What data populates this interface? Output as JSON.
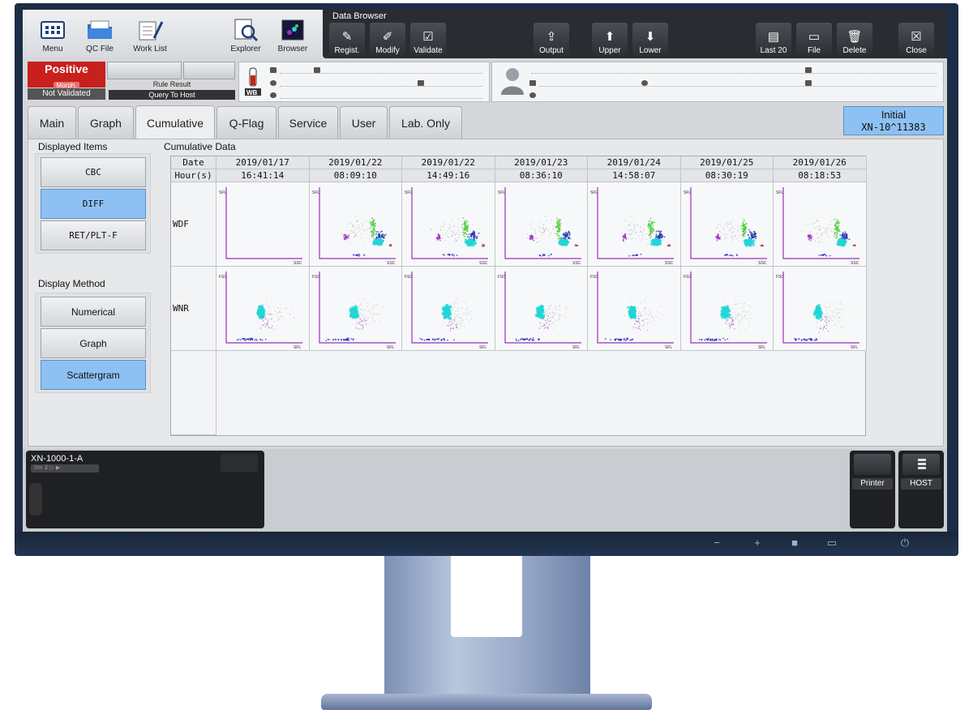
{
  "toolbar": {
    "menu": "Menu",
    "qc_file": "QC File",
    "work_list": "Work List",
    "explorer": "Explorer",
    "browser": "Browser"
  },
  "data_browser": {
    "title": "Data Browser",
    "buttons": [
      {
        "label": "Regist.",
        "glyph": "✎"
      },
      {
        "label": "Modify",
        "glyph": "✐"
      },
      {
        "label": "Validate",
        "glyph": "☑"
      },
      {
        "label": "Output",
        "glyph": "⇪"
      },
      {
        "label": "Upper",
        "glyph": "⬆"
      },
      {
        "label": "Lower",
        "glyph": "⬇"
      },
      {
        "label": "Last 20",
        "glyph": "▤"
      },
      {
        "label": "File",
        "glyph": "▭"
      },
      {
        "label": "Delete",
        "glyph": "🗑"
      },
      {
        "label": "Close",
        "glyph": "☒"
      }
    ]
  },
  "status": {
    "positive": "Positive",
    "morph": "Morph.",
    "not_validated": "Not Validated",
    "rule_result": "Rule Result",
    "query_to_host": "Query To Host",
    "wb": "WB"
  },
  "tabs": [
    "Main",
    "Graph",
    "Cumulative",
    "Q-Flag",
    "Service",
    "User",
    "Lab. Only"
  ],
  "active_tab": "Cumulative",
  "initial": {
    "label": "Initial",
    "sample_id": "XN-10^11383"
  },
  "sidebar": {
    "displayed_items_title": "Displayed Items",
    "displayed_items": [
      "CBC",
      "DIFF",
      "RET/PLT-F"
    ],
    "displayed_selected": "DIFF",
    "display_method_title": "Display Method",
    "display_methods": [
      "Numerical",
      "Graph",
      "Scattergram"
    ],
    "display_method_selected": "Scattergram"
  },
  "cumulative": {
    "title": "Cumulative Data",
    "date_label": "Date",
    "hour_label": "Hour(s)",
    "columns": [
      {
        "date": "2019/01/17",
        "time": "16:41:14"
      },
      {
        "date": "2019/01/22",
        "time": "08:09:10"
      },
      {
        "date": "2019/01/22",
        "time": "14:49:16"
      },
      {
        "date": "2019/01/23",
        "time": "08:36:10"
      },
      {
        "date": "2019/01/24",
        "time": "14:58:07"
      },
      {
        "date": "2019/01/25",
        "time": "08:30:19"
      },
      {
        "date": "2019/01/26",
        "time": "08:18:53"
      }
    ],
    "rows": [
      {
        "label": "WDF",
        "x_axis": "SSC",
        "y_axis": "SFL"
      },
      {
        "label": "WNR",
        "x_axis": "SFL",
        "y_axis": "FSC"
      }
    ]
  },
  "analyzer": {
    "name": "XN-1000-1-A",
    "status": "Xm  ⊻ ▷ ▶"
  },
  "devices": {
    "printer": "Printer",
    "host": "HOST"
  },
  "bezel_controls": [
    "−",
    "+",
    "■",
    "▭",
    "⏻"
  ],
  "colors": {
    "accent_blue": "#8ec1f3",
    "positive_red": "#c8201c",
    "cyan": "#22d6d6",
    "green": "#4ccb3a",
    "purple": "#9b2fc0",
    "navy": "#1b2fb0"
  }
}
